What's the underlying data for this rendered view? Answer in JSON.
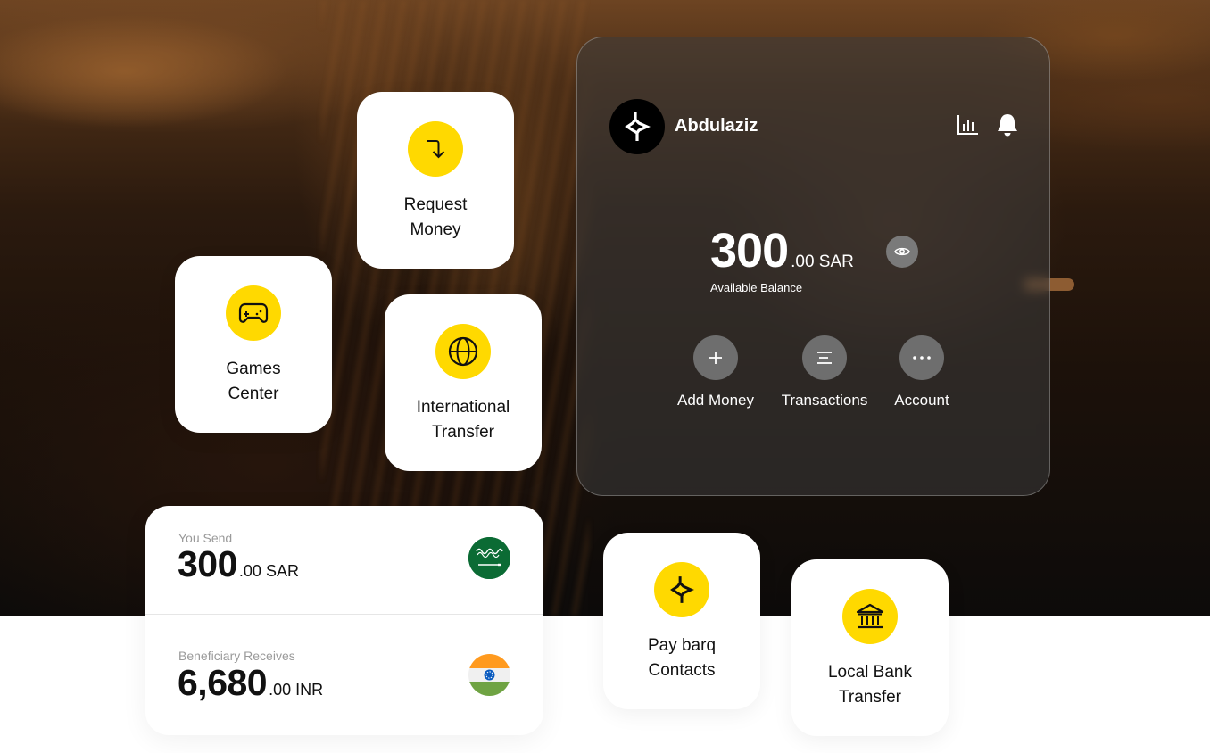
{
  "colors": {
    "accent_yellow": "#FFD900",
    "tile_bg": "#FFFFFF",
    "text_dark": "#111111",
    "text_muted": "#9A9A9A",
    "wallet_glass": "rgba(60,60,60,0.55)",
    "action_circle": "#6E6E6E",
    "flag_sa_green": "#0B6B34",
    "flag_in_saffron": "#FF9933",
    "flag_in_white": "#F2F2F2",
    "flag_in_green": "#6FA343",
    "flag_in_chakra": "#0A5BBF"
  },
  "wallet": {
    "user_name": "Abdulaziz",
    "avatar_icon": "barq-logo-icon",
    "header_icons": [
      "stats-chart-icon",
      "bell-icon"
    ],
    "balance_integer": "300",
    "balance_decimal": ".00 SAR",
    "balance_label": "Available Balance",
    "visibility_icon": "eye-icon",
    "actions": [
      {
        "label": "Add Money",
        "icon": "plus-icon"
      },
      {
        "label": "Transactions",
        "icon": "list-icon"
      },
      {
        "label": "Account",
        "icon": "more-dots-icon"
      }
    ]
  },
  "tiles": [
    {
      "label": "Request\nMoney",
      "icon": "request-arrow-icon"
    },
    {
      "label": "Games\nCenter",
      "icon": "gamepad-icon"
    },
    {
      "label": "International\nTransfer",
      "icon": "globe-icon"
    },
    {
      "label": "Pay barq\nContacts",
      "icon": "barq-logo-icon"
    },
    {
      "label": "Local Bank\nTransfer",
      "icon": "bank-icon"
    }
  ],
  "exchange": {
    "send": {
      "label": "You Send",
      "amount_integer": "300",
      "amount_decimal": ".00 SAR",
      "currency_flag": "saudi-arabia-flag"
    },
    "receive": {
      "label": "Beneficiary Receives",
      "amount_integer": "6,680",
      "amount_decimal": ".00 INR",
      "currency_flag": "india-flag"
    }
  }
}
